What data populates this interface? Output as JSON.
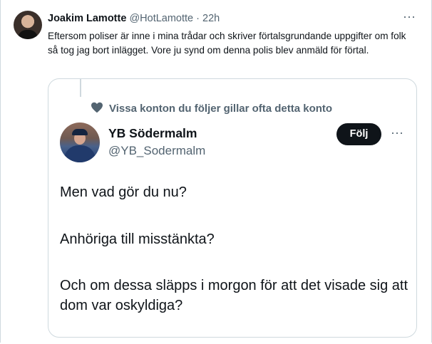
{
  "tweet": {
    "author_name": "Joakim Lamotte",
    "author_handle": "@HotLamotte",
    "separator": "·",
    "time": "22h",
    "more": "···",
    "text": "Eftersom poliser är inne i mina trådar och skriver förtalsgrundande uppgifter om folk så tog jag bort inlägget. Vore ju synd om denna polis blev anmäld för förtal."
  },
  "quoted": {
    "social_context": "Vissa konton du följer gillar ofta detta konto",
    "name": "YB Södermalm",
    "handle": "@YB_Sodermalm",
    "follow_label": "Följ",
    "more": "···",
    "paragraphs": [
      "Men vad gör du nu?",
      "Anhöriga till misstänkta?",
      "Och om dessa släpps i morgon för att det visade sig att dom var oskyldiga?"
    ]
  },
  "colors": {
    "text_primary": "#0f1419",
    "text_secondary": "#536471",
    "border": "#cfd9de",
    "button_bg": "#0f1419"
  }
}
